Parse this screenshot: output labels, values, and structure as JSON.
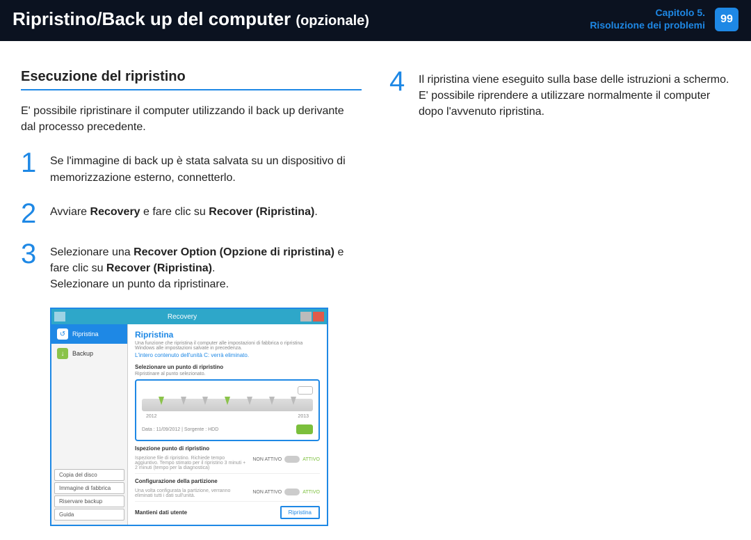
{
  "header": {
    "title": "Ripristino/Back up del computer",
    "subtitle": "(opzionale)",
    "chapter_line1": "Capitolo 5.",
    "chapter_line2": "Risoluzione dei problemi",
    "page": "99"
  },
  "left": {
    "section_title": "Esecuzione del ripristino",
    "intro": "E' possibile ripristinare il computer utilizzando il back up derivante dal processo precedente.",
    "steps": {
      "s1": {
        "num": "1",
        "text": "Se l'immagine di back up è stata salvata su un dispositivo di memorizzazione esterno, connetterlo."
      },
      "s2": {
        "num": "2",
        "pre": "Avviare ",
        "b1": "Recovery",
        "mid": " e fare clic su ",
        "b2": "Recover (Ripristina)",
        "post": "."
      },
      "s3": {
        "num": "3",
        "pre": "Selezionare una ",
        "b1": "Recover Option (Opzione di ripristina)",
        "mid": " e fare clic su ",
        "b2": "Recover (Ripristina)",
        "post": ".",
        "line2": "Selezionare un punto da ripristinare."
      }
    },
    "screenshot": {
      "window_title": "Recovery",
      "sidebar": {
        "items": [
          {
            "label": "Ripristina",
            "icon": "↺"
          },
          {
            "label": "Backup",
            "icon": "↓"
          }
        ],
        "links": [
          "Copia del disco",
          "Immagine di fabbrica",
          "Riservare backup",
          "Guida"
        ]
      },
      "pane": {
        "title": "Ripristina",
        "desc": "Una funzione che ripristina il computer alle impostazioni di fabbrica o ripristina Windows alle impostazioni salvate in precedenza.",
        "warn": "L'intero contenuto dell'unità C: verrà eliminato.",
        "sect1": "Selezionare un punto di ripristino",
        "sect1_sub": "Ripristinare al punto selezionato.",
        "years": {
          "a": "2012",
          "b": "2013"
        },
        "info": "Data : 11/09/2012  |  Sorgente : HDD",
        "sect2": "Ispezione punto di ripristino",
        "sect2_desc": "Ispezione file di ripristino. Richiede tempo aggiuntivo. Tempo stimato per il ripristino 3 minuti + 2 minuti (tempo per la diagnostica)",
        "toggle_off": "NON ATTIVO",
        "toggle_on": "ATTIVO",
        "sect3": "Configurazione della partizione",
        "sect3_desc": "Una volta configurata la partizione, verranno eliminati tutti i dati sull'unità.",
        "foot_label": "Mantieni dati utente",
        "run": "Ripristina"
      }
    }
  },
  "right": {
    "step4_num": "4",
    "step4_p1": "Il ripristina viene eseguito sulla base delle istruzioni a schermo.",
    "step4_p2": "E' possibile riprendere a utilizzare normalmente il computer dopo l'avvenuto ripristina."
  }
}
